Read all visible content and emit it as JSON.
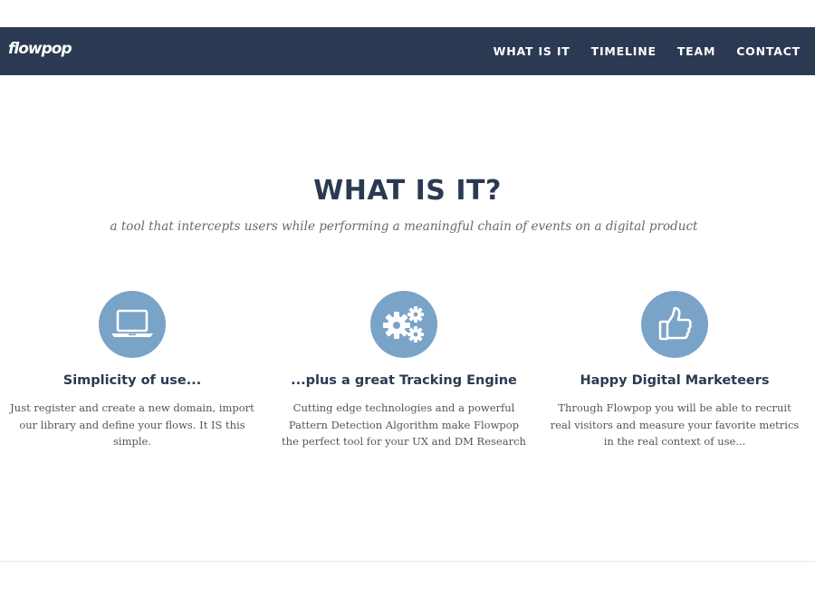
{
  "brand": {
    "logo_text": "flowpop"
  },
  "nav": {
    "items": [
      {
        "label": "WHAT IS IT"
      },
      {
        "label": "TIMELINE"
      },
      {
        "label": "TEAM"
      },
      {
        "label": "CONTACT"
      }
    ]
  },
  "section": {
    "title": "WHAT IS IT?",
    "subtitle": "a tool that intercepts users while performing a meaningful chain of events on a digital product"
  },
  "features": [
    {
      "icon": "laptop-icon",
      "title": "Simplicity of use...",
      "text": "Just register and create a new domain, import our library and define your flows. It IS this simple."
    },
    {
      "icon": "gears-icon",
      "title": "...plus a great Tracking Engine",
      "text": "Cutting edge technologies and a powerful Pattern Detection Algorithm make Flowpop the perfect tool for your UX and DM Research"
    },
    {
      "icon": "thumbs-up-icon",
      "title": "Happy Digital Marketeers",
      "text": "Through Flowpop you will be able to recruit real visitors and measure your favorite metrics in the real context of use..."
    }
  ],
  "colors": {
    "navbar": "#2b3a52",
    "heading": "#2b3a52",
    "icon_circle": "#7aa3c8"
  }
}
